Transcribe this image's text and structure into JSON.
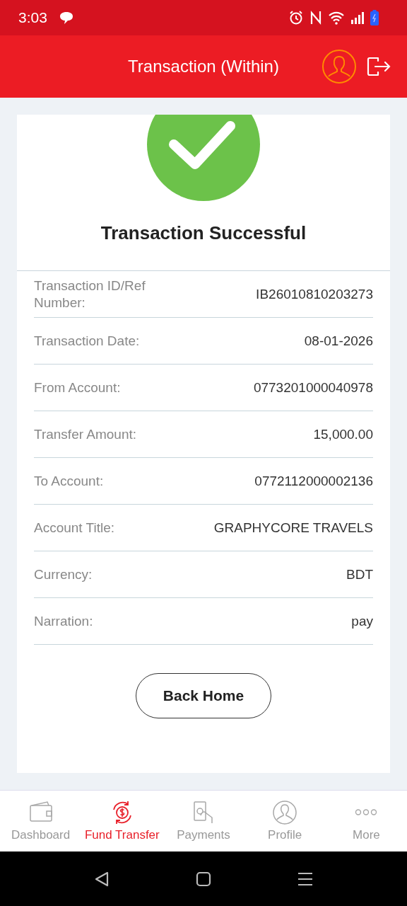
{
  "status_bar": {
    "time": "3:03"
  },
  "header": {
    "title": "Transaction (Within)"
  },
  "result": {
    "title": "Transaction Successful"
  },
  "details": [
    {
      "label": "Transaction ID/Ref Number:",
      "value": "IB26010810203273"
    },
    {
      "label": "Transaction Date:",
      "value": "08-01-2026"
    },
    {
      "label": "From Account:",
      "value": "0773201000040978"
    },
    {
      "label": "Transfer Amount:",
      "value": "15,000.00"
    },
    {
      "label": "To Account:",
      "value": "0772112000002136"
    },
    {
      "label": "Account Title:",
      "value": "GRAPHYCORE TRAVELS"
    },
    {
      "label": "Currency:",
      "value": "BDT"
    },
    {
      "label": "Narration:",
      "value": "pay"
    }
  ],
  "button": {
    "label": "Back Home"
  },
  "bottom_nav": [
    {
      "label": "Dashboard",
      "selected": false
    },
    {
      "label": "Fund Transfer",
      "selected": true
    },
    {
      "label": "Payments",
      "selected": false
    },
    {
      "label": "Profile",
      "selected": false
    },
    {
      "label": "More",
      "selected": false
    }
  ]
}
